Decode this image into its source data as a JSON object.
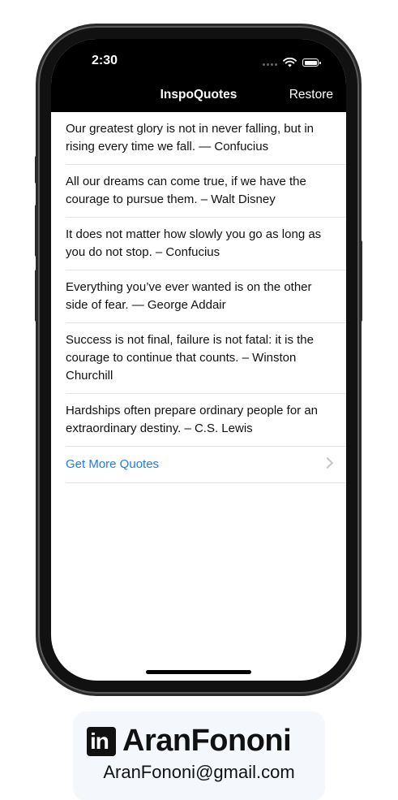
{
  "status_bar": {
    "time": "2:30"
  },
  "nav": {
    "title": "InspoQuotes",
    "restore_label": "Restore"
  },
  "quotes": [
    {
      "text": "Our greatest glory is not in never falling, but in rising every time we fall. — Confucius"
    },
    {
      "text": "All our dreams can come true, if we have the courage to pursue them. – Walt Disney"
    },
    {
      "text": "It does not matter how slowly you go as long as you do not stop. – Confucius"
    },
    {
      "text": "Everything you’ve ever wanted is on the other side of fear. — George Addair"
    },
    {
      "text": "Success is not final, failure is not fatal: it is the courage to continue that counts. – Winston Churchill"
    },
    {
      "text": "Hardships often prepare ordinary people for an extraordinary destiny. – C.S. Lewis"
    }
  ],
  "more": {
    "label": "Get More Quotes"
  },
  "footer": {
    "logo_text": "in",
    "name": "AranFononi",
    "email": "AranFononi@gmail.com"
  },
  "colors": {
    "link": "#1f7de0",
    "nav_background": "#000000",
    "separator": "#e3e3e6"
  },
  "icons": {
    "wifi": "wifi-icon",
    "battery": "battery-icon",
    "signal": "signal-dots-icon",
    "chevron": "chevron-right-icon",
    "linkedin": "linkedin-icon"
  }
}
